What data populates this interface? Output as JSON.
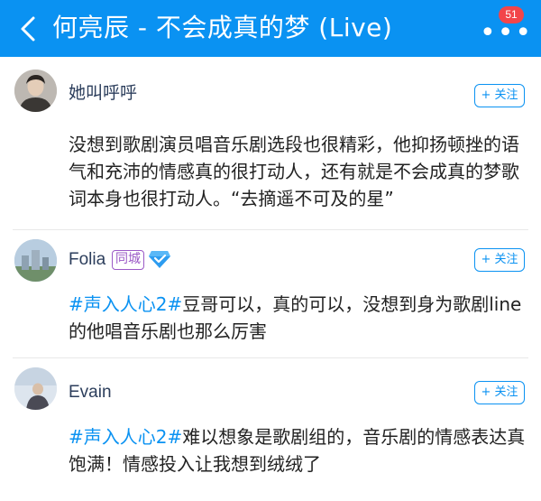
{
  "header": {
    "title": "何亮辰 - 不会成真的梦 (Live)",
    "back_icon": "chevron-left-icon",
    "more_icon": "more-dots-icon",
    "more_dots": "•••",
    "badge_count": "51"
  },
  "colors": {
    "header_bg": "#0a92f2",
    "accent": "#0a92f2",
    "badge": "#f2454a",
    "city_badge": "#9b59c6",
    "username": "#2c3e5c"
  },
  "comments": [
    {
      "username": "她叫呼呼",
      "follow_label": "+ 关注",
      "text": "没想到歌剧演员唱音乐剧选段也很精彩，他抑扬顿挫的语气和充沛的情感真的很打动人，还有就是不会成真的梦歌词本身也很打动人。“去摘遥不可及的星”"
    },
    {
      "username": "Folia",
      "city_badge": "同城",
      "vip_icon": "diamond-vip-icon",
      "follow_label": "+ 关注",
      "hashtag": "#声入人心2#",
      "text": "豆哥可以，真的可以，没想到身为歌剧line的他唱音乐剧也那么厉害"
    },
    {
      "username": "Evain",
      "follow_label": "+ 关注",
      "hashtag": "#声入人心2#",
      "text": "难以想象是歌剧组的，音乐剧的情感表达真饱满！情感投入让我想到绒绒了"
    }
  ]
}
